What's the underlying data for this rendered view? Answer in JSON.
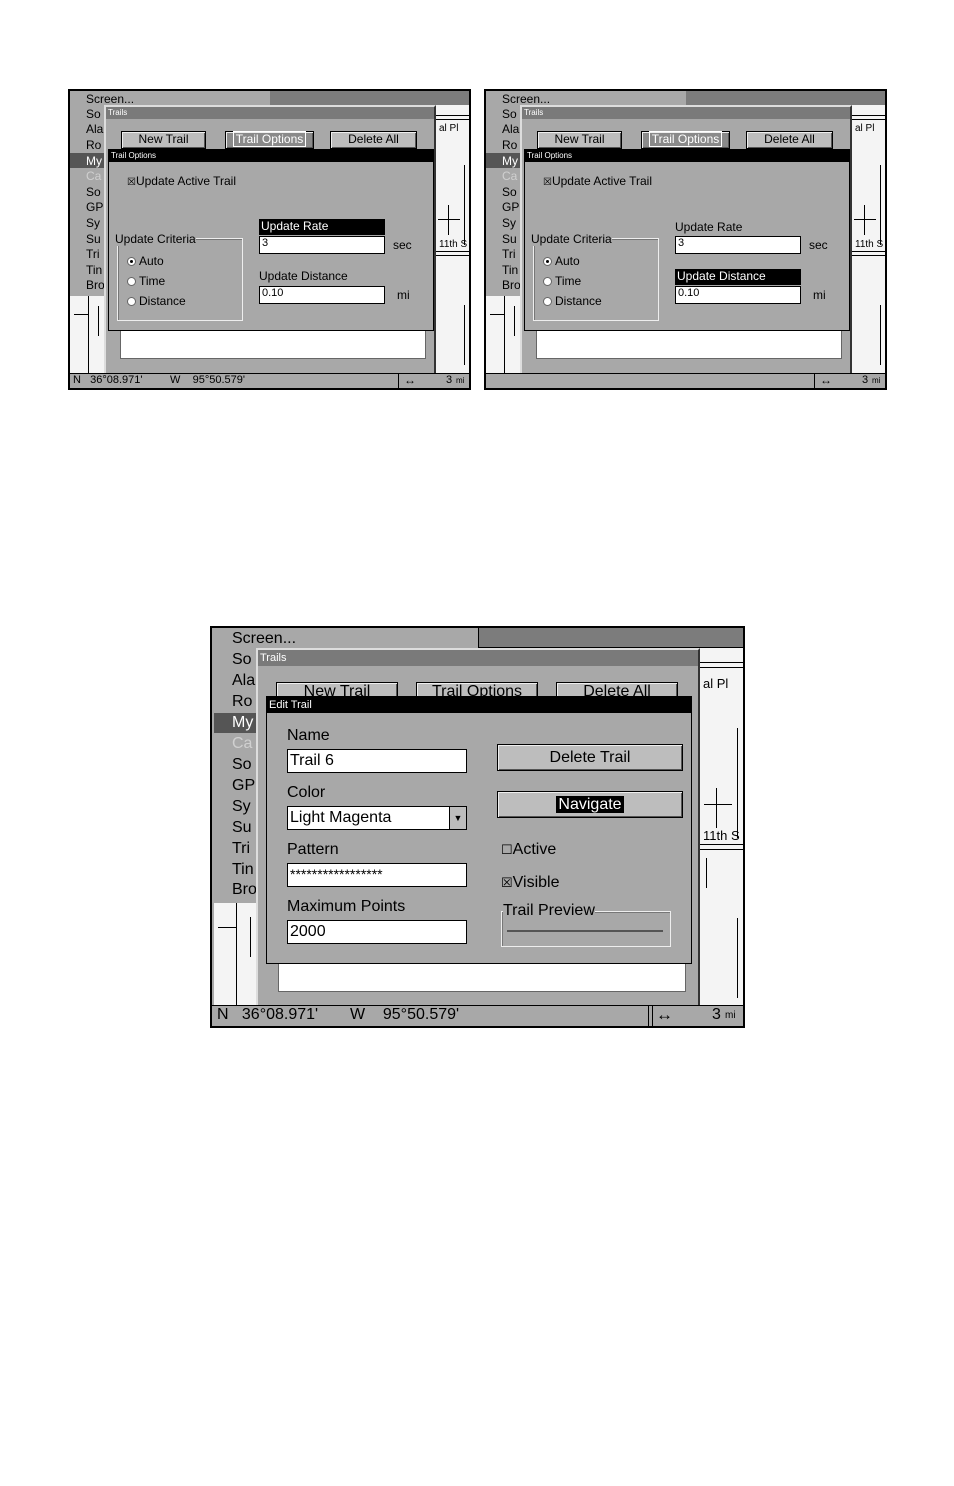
{
  "screens": [
    {
      "menu_items": [
        "Screen...",
        "So",
        "Ala",
        "Ro",
        "My",
        "Ca",
        "So",
        "GP",
        "Sy",
        "Su",
        "Tri",
        "Tin",
        "Bro"
      ],
      "trails_title": "Trails",
      "buttons": {
        "new_trail": "New Trail",
        "trail_options": "Trail Options",
        "delete_all": "Delete All"
      },
      "dialog_title": "Trail Options",
      "update_active_trail": "Update Active Trail",
      "update_criteria": "Update Criteria",
      "criteria": {
        "auto": "Auto",
        "time": "Time",
        "distance": "Distance"
      },
      "update_rate_label": "Update Rate",
      "update_rate_value": "3",
      "update_rate_unit": "sec",
      "update_distance_label": "Update Distance",
      "update_distance_value": "0.10",
      "update_distance_unit": "mi",
      "map_label_1": "al Pl",
      "map_label_2": "11th S",
      "status": {
        "lat": "N   36°08.971'",
        "lon": "W    95°50.579'",
        "arrow": "↔",
        "scale": "3",
        "scale_unit": "mi"
      }
    },
    {
      "menu_items": [
        "Screen...",
        "So",
        "Ala",
        "Ro",
        "My",
        "Ca",
        "So",
        "GP",
        "Sy",
        "Su",
        "Tri",
        "Tin",
        "Bro"
      ],
      "trails_title": "Trails",
      "buttons": {
        "new_trail": "New Trail",
        "trail_options": "Trail Options",
        "delete_all": "Delete All"
      },
      "dialog_title": "Trail Options",
      "update_active_trail": "Update Active Trail",
      "update_criteria": "Update Criteria",
      "criteria": {
        "auto": "Auto",
        "time": "Time",
        "distance": "Distance"
      },
      "update_rate_label": "Update Rate",
      "update_rate_value": "3",
      "update_rate_unit": "sec",
      "update_distance_label": "Update Distance",
      "update_distance_value": "0.10",
      "update_distance_unit": "mi",
      "map_label_1": "al Pl",
      "map_label_2": "11th S",
      "status": {
        "arrow": "↔",
        "scale": "3",
        "scale_unit": "mi"
      }
    }
  ],
  "edit_screen": {
    "menu_items": [
      "Screen...",
      "So",
      "Ala",
      "Ro",
      "My",
      "Ca",
      "So",
      "GP",
      "Sy",
      "Su",
      "Tri",
      "Tin",
      "Bro"
    ],
    "trails_title": "Trails",
    "buttons": {
      "new_trail": "New Trail",
      "trail_options": "Trail Options",
      "delete_all": "Delete All"
    },
    "dialog_title": "Edit Trail",
    "name_label": "Name",
    "name_value": "Trail 6",
    "color_label": "Color",
    "color_value": "Light Magenta",
    "pattern_label": "Pattern",
    "pattern_value": "*****************",
    "max_points_label": "Maximum Points",
    "max_points_value": "2000",
    "delete_trail": "Delete Trail",
    "navigate": "Navigate",
    "active_label": "Active",
    "visible_label": "Visible",
    "trail_preview": "Trail Preview",
    "map_label_1": "al Pl",
    "map_label_2": "11th S",
    "status": {
      "lat": "N   36°08.971'",
      "lon": "W    95°50.579'",
      "arrow": "↔",
      "scale": "3",
      "scale_unit": "mi"
    }
  }
}
